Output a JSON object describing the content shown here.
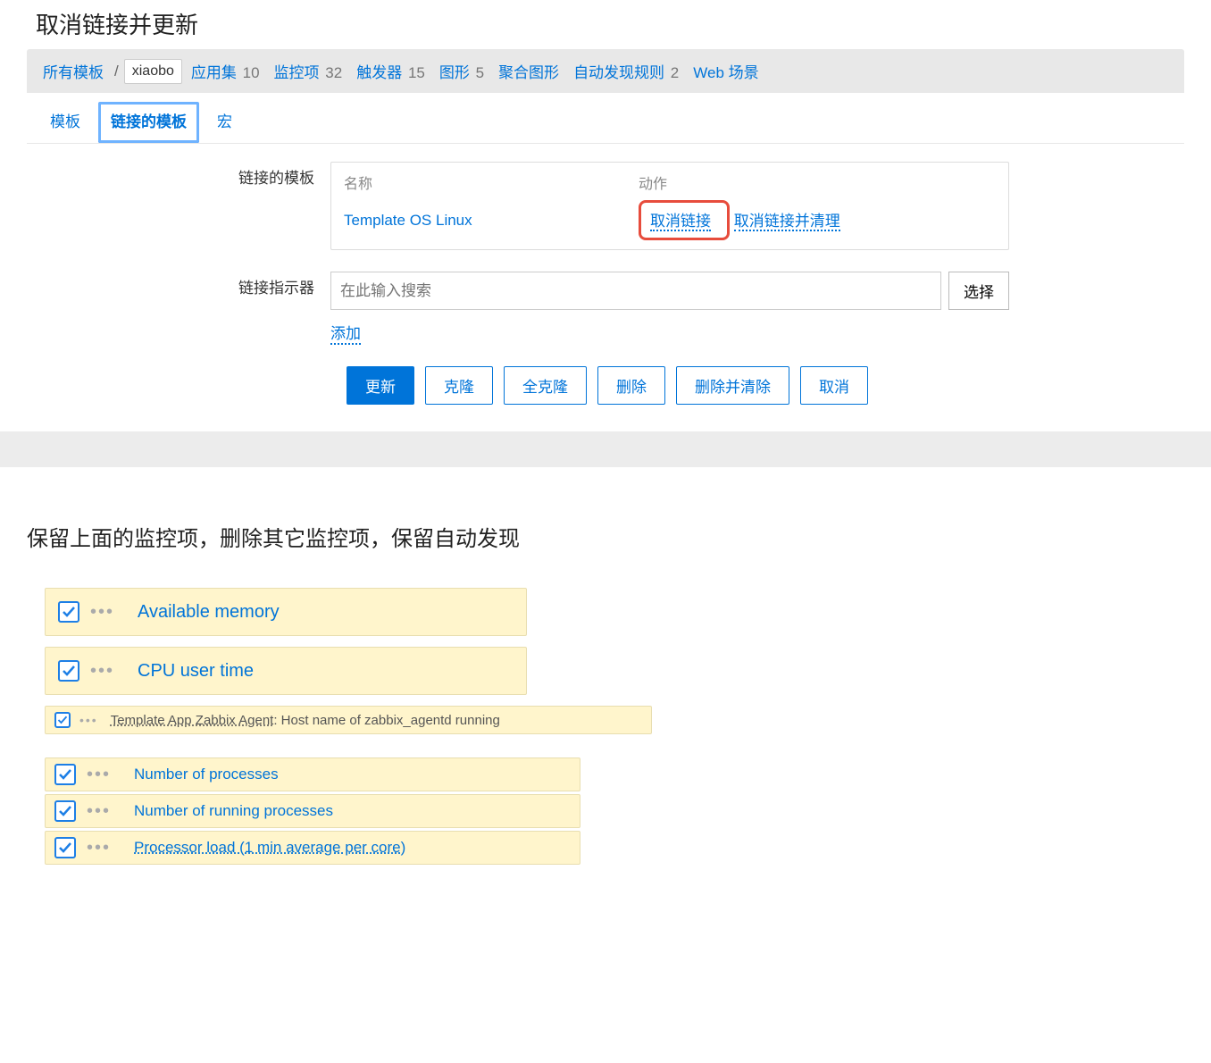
{
  "title1": "取消链接并更新",
  "nav": {
    "all_templates": "所有模板",
    "template_name": "xiaobo",
    "appsets": "应用集",
    "appsets_count": "10",
    "items": "监控项",
    "items_count": "32",
    "triggers": "触发器",
    "triggers_count": "15",
    "graphs": "图形",
    "graphs_count": "5",
    "screens": "聚合图形",
    "discovery": "自动发现规则",
    "discovery_count": "2",
    "web": "Web 场景"
  },
  "tabs": {
    "template": "模板",
    "linked": "链接的模板",
    "macros": "宏"
  },
  "form": {
    "linked_label": "链接的模板",
    "th_name": "名称",
    "th_action": "动作",
    "linked_template": "Template OS Linux",
    "unlink": "取消链接",
    "unlink_clear": "取消链接并清理",
    "indicator_label": "链接指示器",
    "search_placeholder": "在此输入搜索",
    "select": "选择",
    "add": "添加"
  },
  "buttons": {
    "update": "更新",
    "clone": "克隆",
    "full_clone": "全克隆",
    "delete": "删除",
    "delete_clear": "删除并清除",
    "cancel": "取消"
  },
  "title2": "保留上面的监控项，删除其它监控项，保留自动发现",
  "items": {
    "r1": "Available memory",
    "r2": "CPU user time",
    "r3_tpl": "Template App Zabbix Agent",
    "r3_rest": ": Host name of zabbix_agentd running",
    "r4": "Number of processes",
    "r5": "Number of running processes",
    "r6": "Processor load (1 min average per core)"
  }
}
